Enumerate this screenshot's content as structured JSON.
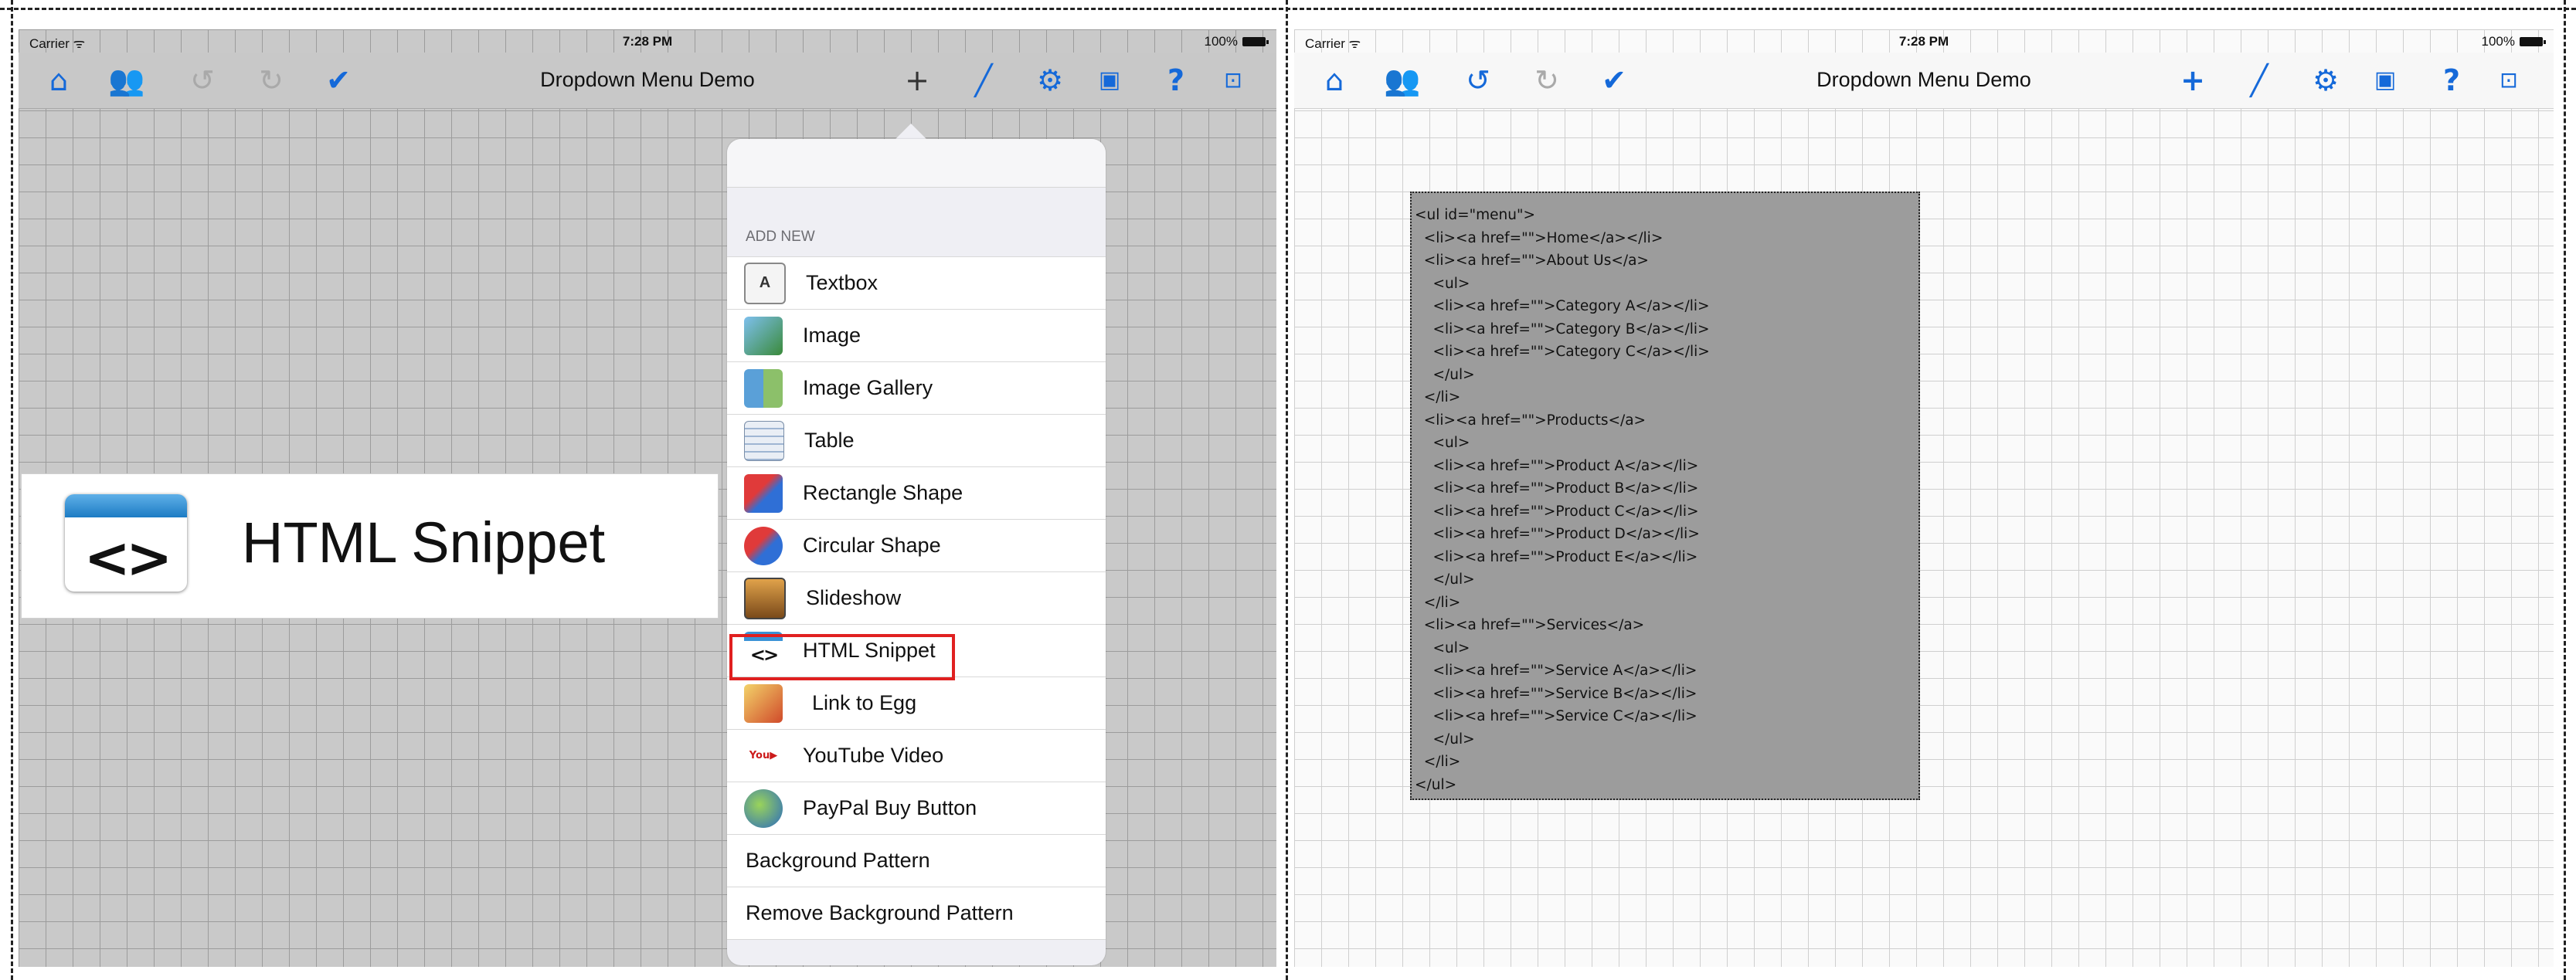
{
  "status_bar": {
    "carrier": "Carrier ᯤ",
    "time": "7:28 PM",
    "battery": "100%"
  },
  "navbar": {
    "title": "Dropdown Menu Demo",
    "icons": [
      "home-icon",
      "users-icon",
      "undo-icon",
      "redo-icon",
      "checkmark-icon",
      "plus-icon",
      "pen-icon",
      "gear-icon",
      "screenshot-icon",
      "help-icon",
      "present-icon"
    ]
  },
  "menu": {
    "section_header": "ADD NEW",
    "items": [
      {
        "label": "Textbox",
        "icon": "textbox-icon"
      },
      {
        "label": "Image",
        "icon": "image-icon"
      },
      {
        "label": "Image Gallery",
        "icon": "image-gallery-icon"
      },
      {
        "label": "Table",
        "icon": "table-icon"
      },
      {
        "label": "Rectangle Shape",
        "icon": "rectangle-shape-icon"
      },
      {
        "label": "Circular Shape",
        "icon": "circular-shape-icon"
      },
      {
        "label": "Slideshow",
        "icon": "slideshow-icon"
      },
      {
        "label": "HTML Snippet",
        "icon": "html-snippet-icon"
      },
      {
        "label": "Link to Egg",
        "icon": "link-to-egg-icon"
      },
      {
        "label": "YouTube Video",
        "icon": "youtube-icon"
      },
      {
        "label": "PayPal Buy Button",
        "icon": "paypal-icon"
      },
      {
        "label": "Background Pattern"
      },
      {
        "label": "Remove Background Pattern"
      }
    ]
  },
  "zoom_callout": {
    "glyph": "<>",
    "label": "HTML Snippet"
  },
  "code_snippet": {
    "lines": [
      "<ul id=\"menu\">",
      "  <li><a href=\"\">Home</a></li>",
      "  <li><a href=\"\">About Us</a>",
      "    <ul>",
      "    <li><a href=\"\">Category A</a></li>",
      "    <li><a href=\"\">Category B</a></li>",
      "    <li><a href=\"\">Category C</a></li>",
      "    </ul>",
      "  </li>",
      "  <li><a href=\"\">Products</a>",
      "    <ul>",
      "    <li><a href=\"\">Product A</a></li>",
      "    <li><a href=\"\">Product B</a></li>",
      "    <li><a href=\"\">Product C</a></li>",
      "    <li><a href=\"\">Product D</a></li>",
      "    <li><a href=\"\">Product E</a></li>",
      "    </ul>",
      "  </li>",
      "  <li><a href=\"\">Services</a>",
      "    <ul>",
      "    <li><a href=\"\">Service A</a></li>",
      "    <li><a href=\"\">Service B</a></li>",
      "    <li><a href=\"\">Service C</a></li>",
      "    </ul>",
      "  </li>",
      "</ul>"
    ]
  },
  "colors": {
    "accent": "#1569d9",
    "highlight": "#e02020"
  }
}
